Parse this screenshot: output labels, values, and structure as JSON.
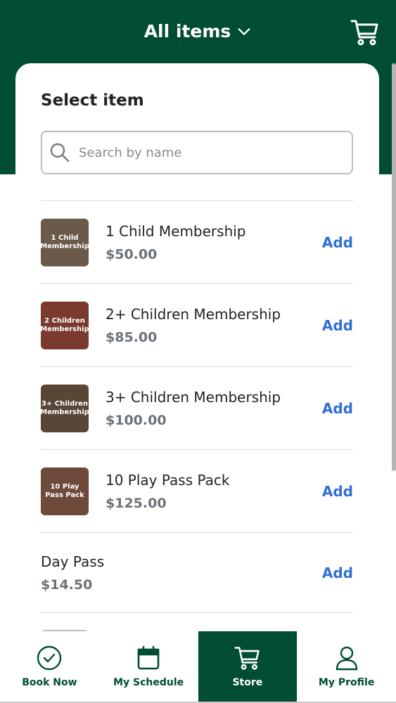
{
  "header": {
    "title": "All items",
    "cart_icon": "cart-icon",
    "dropdown_icon": "chevron-down-icon"
  },
  "panel": {
    "title": "Select item",
    "search": {
      "placeholder": "Search by name",
      "value": ""
    }
  },
  "items": [
    {
      "name": "1 Child Membership",
      "price": "$50.00",
      "action": "Add",
      "thumb_text": "1 Child Membership",
      "thumb_color": "#6b5a4a"
    },
    {
      "name": "2+ Children Membership",
      "price": "$85.00",
      "action": "Add",
      "thumb_text": "2 Children Membership",
      "thumb_color": "#7a3b2e"
    },
    {
      "name": "3+ Children Membership",
      "price": "$100.00",
      "action": "Add",
      "thumb_text": "3+ Children Membership",
      "thumb_color": "#5a4636"
    },
    {
      "name": "10 Play Pass Pack",
      "price": "$125.00",
      "action": "Add",
      "thumb_text": "10 Play Pass Pack",
      "thumb_color": "#6e4a3a"
    },
    {
      "name": "Day Pass",
      "price": "$14.50",
      "action": "Add"
    }
  ],
  "nav": [
    {
      "label": "Book Now",
      "icon": "check-circle-icon",
      "active": false
    },
    {
      "label": "My Schedule",
      "icon": "calendar-icon",
      "active": false
    },
    {
      "label": "Store",
      "icon": "cart-icon",
      "active": true
    },
    {
      "label": "My Profile",
      "icon": "user-icon",
      "active": false
    }
  ],
  "colors": {
    "brand_green": "#004d33",
    "link_blue": "#2f6fd6",
    "price_gray": "#6d7278"
  }
}
